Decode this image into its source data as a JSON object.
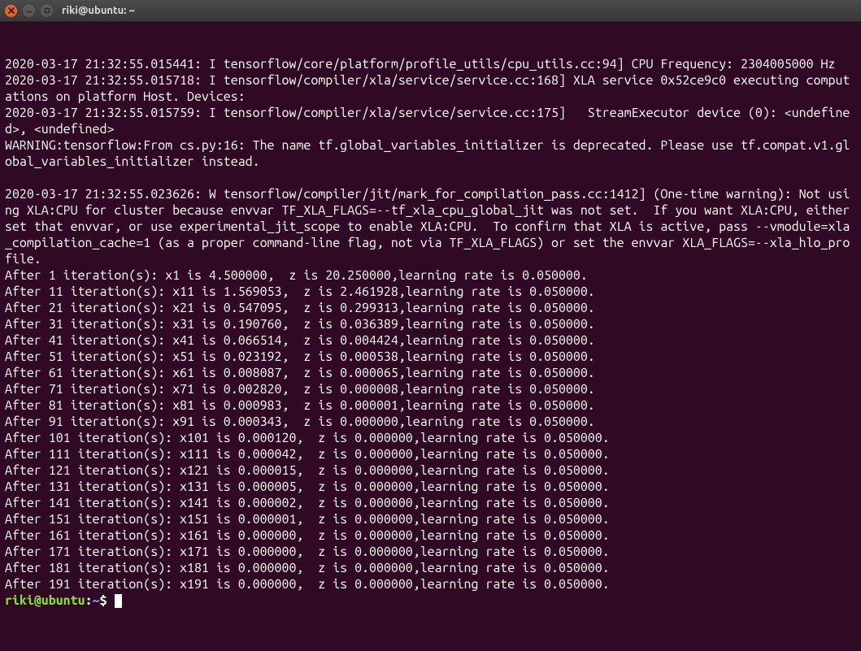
{
  "window": {
    "title": "riki@ubuntu: ~"
  },
  "prompt": {
    "user_host": "riki@ubuntu",
    "sep": ":",
    "path": "~",
    "symbol": "$"
  },
  "terminal": {
    "lines": [
      "2020-03-17 21:32:55.015441: I tensorflow/core/platform/profile_utils/cpu_utils.cc:94] CPU Frequency: 2304005000 Hz",
      "2020-03-17 21:32:55.015718: I tensorflow/compiler/xla/service/service.cc:168] XLA service 0x52ce9c0 executing computations on platform Host. Devices:",
      "2020-03-17 21:32:55.015759: I tensorflow/compiler/xla/service/service.cc:175]   StreamExecutor device (0): <undefined>, <undefined>",
      "WARNING:tensorflow:From cs.py:16: The name tf.global_variables_initializer is deprecated. Please use tf.compat.v1.global_variables_initializer instead.",
      "",
      "2020-03-17 21:32:55.023626: W tensorflow/compiler/jit/mark_for_compilation_pass.cc:1412] (One-time warning): Not using XLA:CPU for cluster because envvar TF_XLA_FLAGS=--tf_xla_cpu_global_jit was not set.  If you want XLA:CPU, either set that envvar, or use experimental_jit_scope to enable XLA:CPU.  To confirm that XLA is active, pass --vmodule=xla_compilation_cache=1 (as a proper command-line flag, not via TF_XLA_FLAGS) or set the envvar XLA_FLAGS=--xla_hlo_profile.",
      "After 1 iteration(s): x1 is 4.500000,  z is 20.250000,learning rate is 0.050000.",
      "After 11 iteration(s): x11 is 1.569053,  z is 2.461928,learning rate is 0.050000.",
      "After 21 iteration(s): x21 is 0.547095,  z is 0.299313,learning rate is 0.050000.",
      "After 31 iteration(s): x31 is 0.190760,  z is 0.036389,learning rate is 0.050000.",
      "After 41 iteration(s): x41 is 0.066514,  z is 0.004424,learning rate is 0.050000.",
      "After 51 iteration(s): x51 is 0.023192,  z is 0.000538,learning rate is 0.050000.",
      "After 61 iteration(s): x61 is 0.008087,  z is 0.000065,learning rate is 0.050000.",
      "After 71 iteration(s): x71 is 0.002820,  z is 0.000008,learning rate is 0.050000.",
      "After 81 iteration(s): x81 is 0.000983,  z is 0.000001,learning rate is 0.050000.",
      "After 91 iteration(s): x91 is 0.000343,  z is 0.000000,learning rate is 0.050000.",
      "After 101 iteration(s): x101 is 0.000120,  z is 0.000000,learning rate is 0.050000.",
      "After 111 iteration(s): x111 is 0.000042,  z is 0.000000,learning rate is 0.050000.",
      "After 121 iteration(s): x121 is 0.000015,  z is 0.000000,learning rate is 0.050000.",
      "After 131 iteration(s): x131 is 0.000005,  z is 0.000000,learning rate is 0.050000.",
      "After 141 iteration(s): x141 is 0.000002,  z is 0.000000,learning rate is 0.050000.",
      "After 151 iteration(s): x151 is 0.000001,  z is 0.000000,learning rate is 0.050000.",
      "After 161 iteration(s): x161 is 0.000000,  z is 0.000000,learning rate is 0.050000.",
      "After 171 iteration(s): x171 is 0.000000,  z is 0.000000,learning rate is 0.050000.",
      "After 181 iteration(s): x181 is 0.000000,  z is 0.000000,learning rate is 0.050000.",
      "After 191 iteration(s): x191 is 0.000000,  z is 0.000000,learning rate is 0.050000."
    ]
  }
}
